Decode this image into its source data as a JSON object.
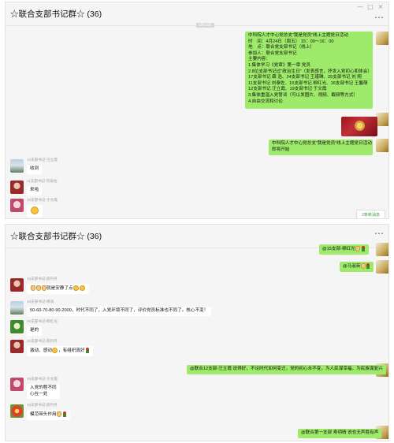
{
  "panel1": {
    "title": "☆联合支部书记群☆ (36)",
    "more_icon": "⋯",
    "window_controls": [
      "—",
      "□",
      "×"
    ],
    "timestamp": "4月23日",
    "notice_lines": [
      "中科院人才中心党总支“我是党员”线上主题党日活动",
      "时　间：4月24日（周五） 15：00～16：00",
      "地　点：联合党支部书记（线上）",
      "参加人：联合党支部书记",
      "主要内容：",
      "1.集体学习《党章》第一章 党员",
      "2.8位支部书记过“政治生日”（发表感言，抒发入党初心和体会）",
      "  17支部书记 薛 浩、24支部书记 王瑾琳、25支部书记 刘 翔",
      "  11支部书记 刘泰佐、15支部书记 柳红光、16支部书记 王馨萌",
      "  12支部书记 汪立霞、19支部书记 于文霞",
      "3.集体重温入党誓词（可以发图片、视频、截频等方式）",
      "4.自由交流和讨论"
    ],
    "start_lines": [
      "中科院人才中心党总支“我是党员”线上主题党日活动",
      "即将开始"
    ],
    "msg1_sender": "12支部书记-汪立霞",
    "msg1_text": "收到",
    "msg2_sender": "11支部书记-刘泰佐",
    "msg2_text": "来啦",
    "msg3_sender": "19支部书记-于文霞",
    "new_messages": "2条新消息"
  },
  "panel2": {
    "title": "☆联合支部书记群☆ (36)",
    "more_icon": "⋯",
    "window_controls": [
      "—",
      "□",
      "×"
    ],
    "out1_text": "@15支部-柳红光",
    "out2_text": "@马淑英",
    "msg1_sender": "16支部书记-薛丹丹",
    "msg1_text": "就是安静了点",
    "msg2_sender": "16支部书记-杨涛",
    "msg2_text": "50-60-70-80-90-2000，时代不同了，入党环境不同了，评价党员标准也不同了。核心不变！",
    "msg3_sender": "20支部书记-柳红光",
    "msg3_text": "是的",
    "msg4_sender": "24支部书记-薛丹丹",
    "msg4_text_a": "激动、感动",
    "msg4_text_b": "，有组织真好",
    "out3_text": "@联合12支部-汪立霞 说得好，不论时代如何变迁，党的初心永不变，为人民谋幸福，为民族谋复兴",
    "msg5_sender": "19支部书记-于文霞",
    "msg5_lines": [
      "入党的程不同",
      "心在一处"
    ],
    "msg6_sender": "16支部书记-薛丹丹",
    "msg6_text": "模范带头作用",
    "out4_text": "@联合第一支部 寿玥晴 说也无声胜有声"
  }
}
